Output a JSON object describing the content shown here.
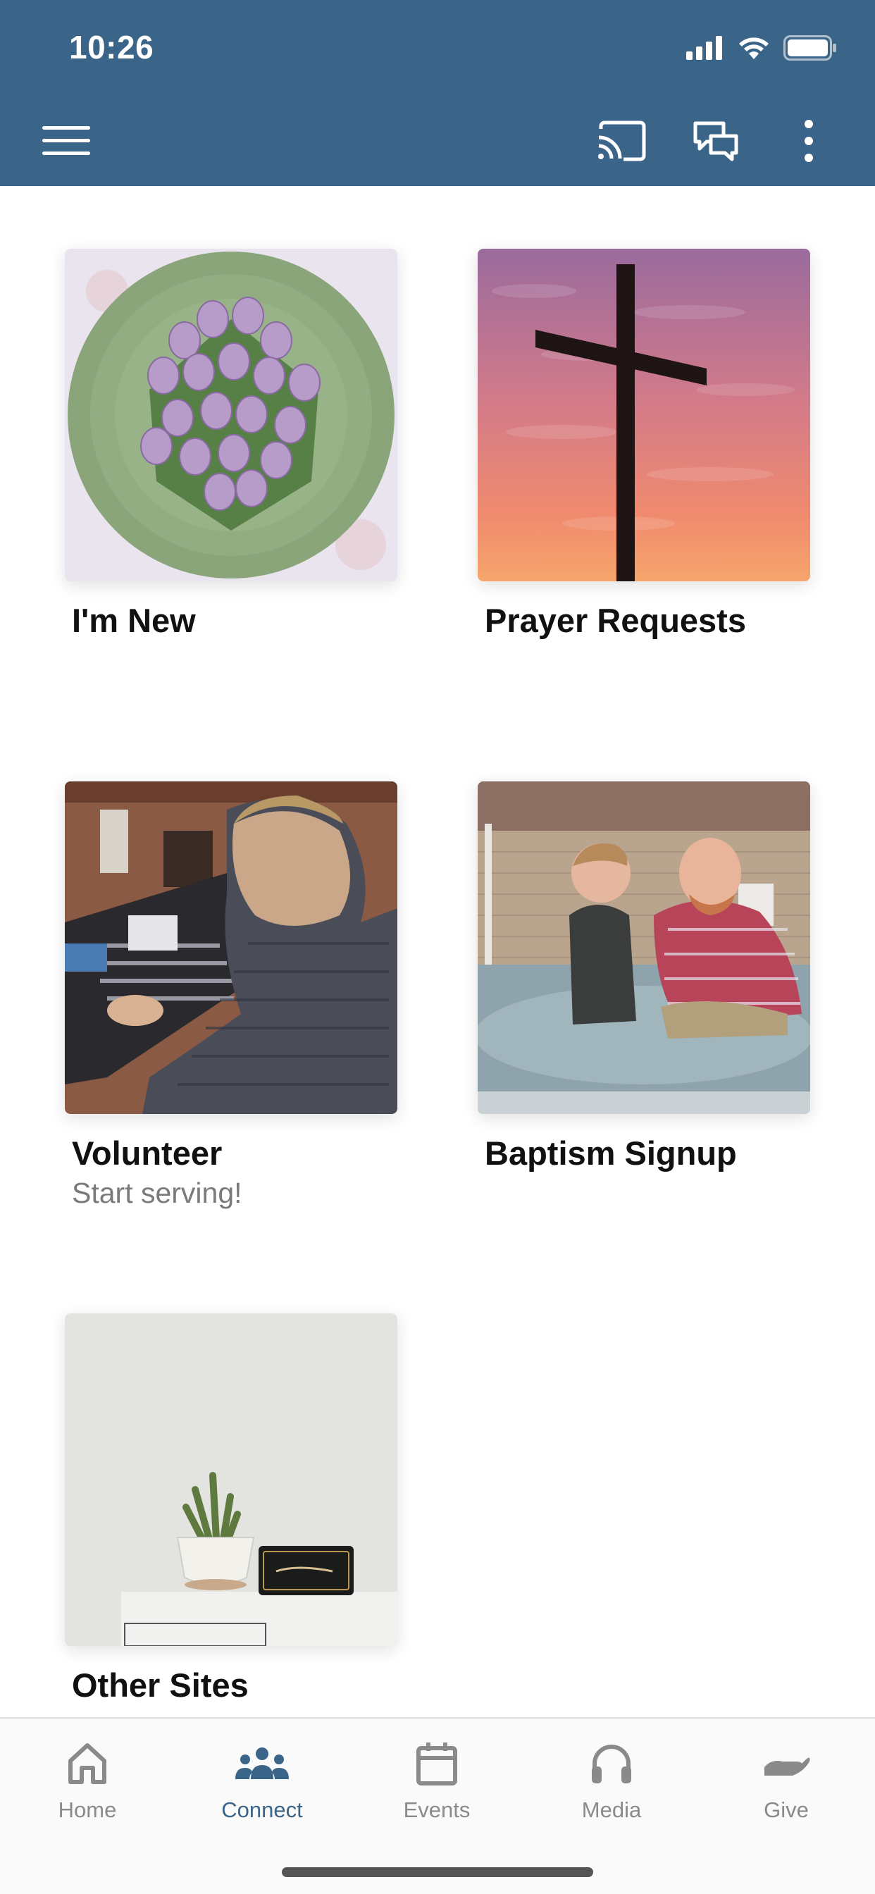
{
  "status_bar": {
    "time": "10:26",
    "icons": [
      "cellular-signal-icon",
      "wifi-icon",
      "battery-icon"
    ]
  },
  "app_bar": {
    "color": "#3a6589",
    "left_icon": "menu-icon",
    "right_icons": [
      "cast-icon",
      "chat-icon",
      "more-vertical-icon"
    ]
  },
  "grid": {
    "items": [
      {
        "title": "I'm New",
        "subtitle": "",
        "image": "tulips-bouquet-photo"
      },
      {
        "title": "Prayer Requests",
        "subtitle": "",
        "image": "cross-sunset-photo"
      },
      {
        "title": "Volunteer",
        "subtitle": "Start serving!",
        "image": "sound-board-photo"
      },
      {
        "title": "Baptism Signup",
        "subtitle": "",
        "image": "baptism-pool-photo"
      },
      {
        "title": "Other Sites",
        "subtitle": "",
        "image": "cactus-speaker-photo"
      }
    ]
  },
  "tab_bar": {
    "active_color": "#3a6589",
    "inactive_color": "#8a8a8a",
    "tabs": [
      {
        "label": "Home",
        "icon": "home-icon",
        "active": false
      },
      {
        "label": "Connect",
        "icon": "people-group-icon",
        "active": true
      },
      {
        "label": "Events",
        "icon": "calendar-icon",
        "active": false
      },
      {
        "label": "Media",
        "icon": "headphones-icon",
        "active": false
      },
      {
        "label": "Give",
        "icon": "giving-hand-icon",
        "active": false
      }
    ]
  }
}
